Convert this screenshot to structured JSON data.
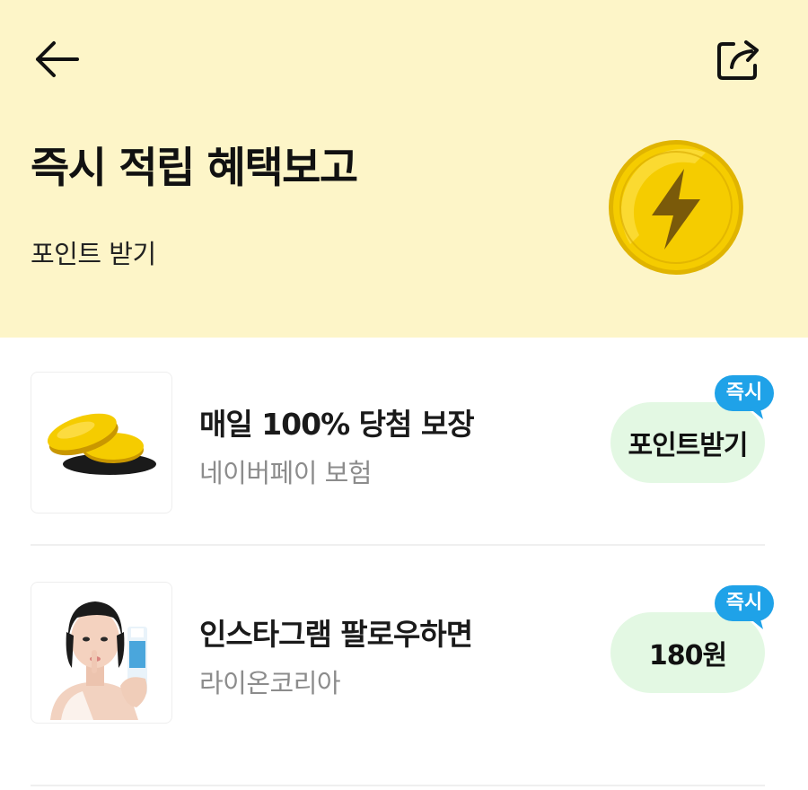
{
  "header": {
    "back_icon": "arrow-left-icon",
    "share_icon": "share-icon",
    "title": "즉시 적립 혜택보고",
    "subtitle": "포인트 받기",
    "hero_icon": "lightning-coin-icon"
  },
  "colors": {
    "hero_bg": "#fdf5c8",
    "cta_bg": "#e3f8e3",
    "badge_bg": "#1fa2e8",
    "coin_gold": "#f5cc00"
  },
  "items": [
    {
      "title": "매일 100% 당첨 보장",
      "subtitle": "네이버페이 보험",
      "cta_label": "포인트받기",
      "badge": "즉시",
      "thumbnail": "gold-coins-image"
    },
    {
      "title": "인스타그램 팔로우하면",
      "subtitle": "라이온코리아",
      "cta_label": "180원",
      "badge": "즉시",
      "thumbnail": "model-with-toothpaste-photo"
    }
  ]
}
